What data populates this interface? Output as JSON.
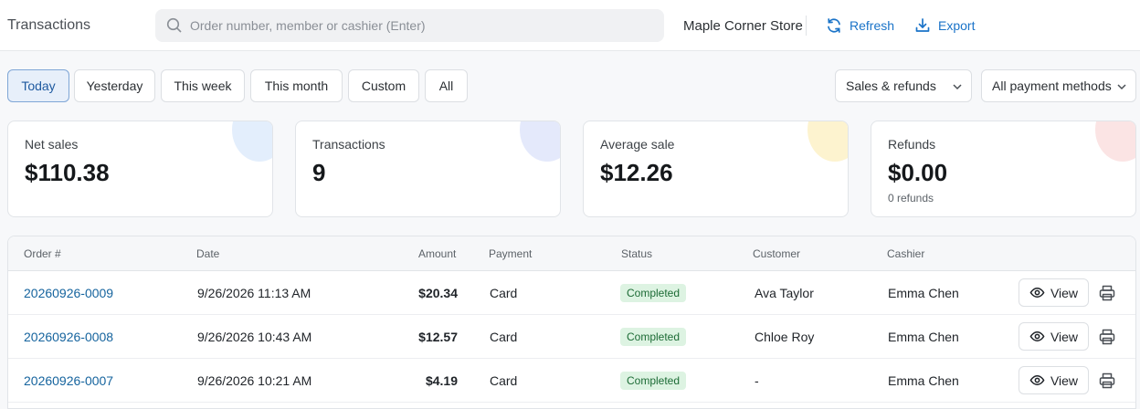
{
  "header": {
    "title": "Transactions",
    "search_placeholder": "Order number, member or cashier (Enter)",
    "search_value": "",
    "store_name": "Maple Corner Store",
    "refresh_label": "Refresh",
    "export_label": "Export"
  },
  "filters": {
    "ranges": [
      "Today",
      "Yesterday",
      "This week",
      "This month",
      "Custom",
      "All"
    ],
    "active_range": "Today",
    "type_select": "Sales & refunds",
    "payment_select": "All payment methods"
  },
  "stats": [
    {
      "label": "Net sales",
      "value": "$110.38",
      "sub": "",
      "accent": "#e3eefc"
    },
    {
      "label": "Transactions",
      "value": "9",
      "sub": "",
      "accent": "#e4e9fb"
    },
    {
      "label": "Average sale",
      "value": "$12.26",
      "sub": "",
      "accent": "#fdf3cf"
    },
    {
      "label": "Refunds",
      "value": "$0.00",
      "sub": "0 refunds",
      "accent": "#fbe4e4"
    }
  ],
  "table": {
    "columns": [
      "Order #",
      "Date",
      "Amount",
      "Payment",
      "Status",
      "Customer",
      "Cashier"
    ],
    "view_label": "View",
    "rows": [
      {
        "order": "20260926-0009",
        "date": "9/26/2026 11:13 AM",
        "amount": "$20.34",
        "payment": "Card",
        "status": "Completed",
        "customer": "Ava Taylor",
        "cashier": "Emma Chen"
      },
      {
        "order": "20260926-0008",
        "date": "9/26/2026 10:43 AM",
        "amount": "$12.57",
        "payment": "Card",
        "status": "Completed",
        "customer": "Chloe Roy",
        "cashier": "Emma Chen"
      },
      {
        "order": "20260926-0007",
        "date": "9/26/2026 10:21 AM",
        "amount": "$4.19",
        "payment": "Card",
        "status": "Completed",
        "customer": "-",
        "cashier": "Emma Chen"
      }
    ]
  },
  "colors": {
    "accent": "#1a73c8",
    "link": "#16649e",
    "status_completed_bg": "#ddf3e2",
    "status_completed_text": "#1c6b35"
  },
  "icons": [
    "search-icon",
    "refresh-icon",
    "export-icon",
    "chevron-down-icon",
    "eye-icon",
    "printer-icon"
  ]
}
